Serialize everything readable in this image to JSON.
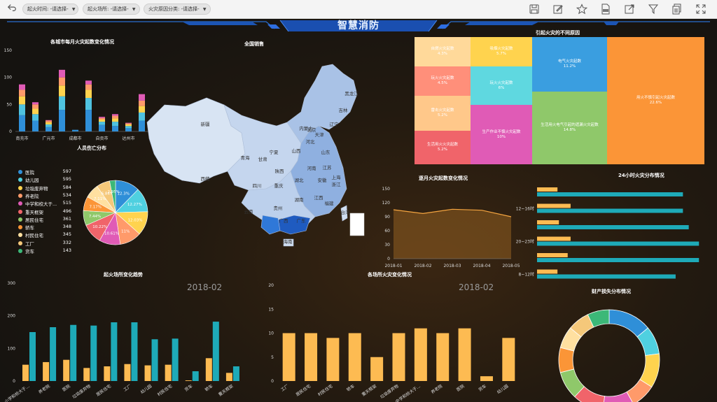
{
  "toolbar": {
    "filters": [
      {
        "label": "起火时间:",
        "value": "-请选择-"
      },
      {
        "label": "起火场所:",
        "value": "-请选择-"
      },
      {
        "label": "火灾原因分类:",
        "value": "-请选择-"
      }
    ],
    "icons": [
      "back-icon",
      "save-icon",
      "edit-icon",
      "star-icon",
      "pdf-icon",
      "export-icon",
      "filter-icon",
      "copy-icon",
      "fullscreen-icon"
    ]
  },
  "header": {
    "title": "智慧消防"
  },
  "panels": {
    "city_monthly": {
      "title": "各城市每月火灾起数变化情况"
    },
    "national": {
      "title": "全国销售"
    },
    "causes": {
      "title": "引起火灾的不同原因"
    },
    "casualty": {
      "title": "人员伤亡分布"
    },
    "monthly_trend": {
      "title": "逐月火灾起数变化情况"
    },
    "hourly": {
      "title": "24小时火灾分布情况"
    },
    "site_trend": {
      "title": "起火场所变化趋势",
      "date": "2018-02"
    },
    "site_change": {
      "title": "各场所火灾变化情况",
      "date": "2018-02"
    },
    "loss": {
      "title": "财产损失分布情况"
    }
  },
  "map_labels": [
    "黑龙江",
    "吉林",
    "辽宁",
    "内蒙古",
    "北京",
    "天津",
    "河北",
    "山西",
    "山东",
    "河南",
    "陕西",
    "宁夏",
    "甘肃",
    "青海",
    "新疆",
    "西藏",
    "四川",
    "重庆",
    "湖北",
    "安徽",
    "江苏",
    "上海",
    "浙江",
    "湖南",
    "江西",
    "福建",
    "贵州",
    "云南",
    "广西",
    "广东",
    "海南",
    "台湾"
  ],
  "chart_data": [
    {
      "id": "city_monthly",
      "type": "bar",
      "stacked": true,
      "categories": [
        "南充市",
        "",
        "广元市",
        "",
        "成都市",
        "",
        "自贡市",
        "",
        "达州市",
        ""
      ],
      "x_tick_labels": [
        "南充市",
        "广元市",
        "成都市",
        "自贡市",
        "达州市"
      ],
      "ylim": [
        0,
        150
      ],
      "yticks": [
        0,
        50,
        100,
        150
      ],
      "colors": [
        "#2f8fd8",
        "#4fc3e0",
        "#ffd34e",
        "#ff9a6a",
        "#e05bb6"
      ],
      "series": [
        {
          "values": [
            30,
            20,
            8,
            40,
            3,
            40,
            12,
            10,
            6,
            20
          ]
        },
        {
          "values": [
            20,
            12,
            5,
            25,
            0,
            22,
            6,
            8,
            4,
            15
          ]
        },
        {
          "values": [
            15,
            10,
            4,
            20,
            0,
            15,
            4,
            6,
            3,
            12
          ]
        },
        {
          "values": [
            12,
            8,
            3,
            15,
            0,
            10,
            3,
            5,
            2,
            10
          ]
        },
        {
          "values": [
            10,
            4,
            1,
            14,
            0,
            7,
            2,
            3,
            1,
            12
          ]
        }
      ]
    },
    {
      "id": "causes",
      "type": "treemap",
      "cells": [
        {
          "name": "用火不慎引起火灾起数",
          "value": "22.6%",
          "color": "#fb9537"
        },
        {
          "name": "电气火灾起数",
          "value": "11.2%",
          "color": "#3a9ee0"
        },
        {
          "name": "生活用火电气引起的遗漏火灾起数",
          "value": "14.8%",
          "color": "#8fc86a"
        },
        {
          "name": "吸烟火灾起数",
          "value": "5.7%",
          "color": "#ffd34e"
        },
        {
          "name": "玩火火灾起数",
          "value": "6%",
          "color": "#5fd8e0"
        },
        {
          "name": "生产作业不慎火灾起数",
          "value": "10%",
          "color": "#e05bb6"
        },
        {
          "name": "自燃火灾起数",
          "value": "4.3%",
          "color": "#ffd99a"
        },
        {
          "name": "玩火火灾起数",
          "value": "4.5%",
          "color": "#ff8f7a"
        },
        {
          "name": "雷击火灾起数",
          "value": "5.2%",
          "color": "#ffc88a"
        },
        {
          "name": "生活用火火灾起数",
          "value": "5.2%",
          "color": "#f0646a"
        }
      ]
    },
    {
      "id": "casualty",
      "type": "pie",
      "legend": [
        {
          "name": "医院",
          "value": 597,
          "color": "#2f8fd8"
        },
        {
          "name": "幼儿园",
          "value": 595,
          "color": "#4fd0e0"
        },
        {
          "name": "垃圾废弃物",
          "value": 584,
          "color": "#ffd34e"
        },
        {
          "name": "养老院",
          "value": 534,
          "color": "#ff9a6a"
        },
        {
          "name": "中学和校大于...",
          "value": 515,
          "color": "#e05bb6"
        },
        {
          "name": "重天框架",
          "value": 496,
          "color": "#f0646a"
        },
        {
          "name": "居民住宅",
          "value": 361,
          "color": "#8fc86a"
        },
        {
          "name": "轿车",
          "value": 348,
          "color": "#fb9537"
        },
        {
          "name": "村民住宅",
          "value": 345,
          "color": "#ffe0a0"
        },
        {
          "name": "工厂",
          "value": 332,
          "color": "#f5c87a"
        },
        {
          "name": "货车",
          "value": 143,
          "color": "#3cb878"
        }
      ],
      "slice_labels": [
        "12.3%",
        "12.27%",
        "12.03%",
        "11%",
        "10.61%",
        "10.22%",
        "7.44%",
        "7.17%",
        "7.11%",
        "6.84%",
        "2.95%"
      ]
    },
    {
      "id": "monthly_trend",
      "type": "area",
      "x": [
        "2018-01",
        "2018-02",
        "2018-03",
        "2018-04",
        "2018-05"
      ],
      "values": [
        105,
        97,
        106,
        104,
        90
      ],
      "ylim": [
        0,
        150
      ],
      "yticks": [
        0,
        30,
        60,
        90,
        120,
        150
      ]
    },
    {
      "id": "hourly",
      "type": "bar",
      "orientation": "horizontal",
      "categories": [
        "8~12时",
        "",
        "20~23时",
        "",
        "12~16时",
        ""
      ],
      "tick_labels": [
        "12~16时",
        "20~23时",
        "8~12时"
      ],
      "series": [
        {
          "name": "",
          "color": "#fdbb52",
          "values": [
            14,
            21,
            23,
            15,
            23,
            14
          ]
        },
        {
          "name": "",
          "color": "#1eaab8",
          "values": [
            95,
            111,
            111,
            104,
            100,
            100
          ]
        }
      ],
      "xlim": [
        0,
        120
      ]
    },
    {
      "id": "site_trend",
      "type": "bar",
      "categories": [
        "小学和校大于...",
        "养老院",
        "医院",
        "垃圾废弃物",
        "居民住宅",
        "工厂",
        "幼儿园",
        "村民住宅",
        "货车",
        "轿车",
        "重天框架"
      ],
      "ylim": [
        0,
        300
      ],
      "yticks": [
        0,
        100,
        200,
        300
      ],
      "series": [
        {
          "name": "",
          "color": "#fdbb52",
          "values": [
            50,
            58,
            65,
            40,
            45,
            52,
            48,
            50,
            2,
            70,
            25
          ]
        },
        {
          "name": "",
          "color": "#1eaab8",
          "values": [
            150,
            165,
            172,
            170,
            180,
            180,
            128,
            130,
            30,
            182,
            45
          ]
        }
      ]
    },
    {
      "id": "site_change",
      "type": "bar",
      "categories": [
        "工厂",
        "居民住宅",
        "村民住宅",
        "轿车",
        "重天框架",
        "垃圾废弃物",
        "中学和校大于...",
        "养老院",
        "医院",
        "货车",
        "幼儿园"
      ],
      "ylim": [
        0,
        20
      ],
      "yticks": [
        0,
        5,
        10,
        15,
        20
      ],
      "values": [
        10,
        10,
        9,
        10,
        5,
        10,
        11,
        10,
        11,
        1,
        9
      ],
      "color": "#fdbb52"
    },
    {
      "id": "loss",
      "type": "pie",
      "donut": true,
      "values": [
        14,
        9,
        11,
        8,
        10,
        10,
        9,
        8,
        7,
        7,
        7
      ],
      "colors": [
        "#2f8fd8",
        "#4fd0e0",
        "#ffd34e",
        "#ff9a6a",
        "#e05bb6",
        "#f0646a",
        "#8fc86a",
        "#fb9537",
        "#ffe0a0",
        "#f5c87a",
        "#3cb878"
      ]
    }
  ]
}
